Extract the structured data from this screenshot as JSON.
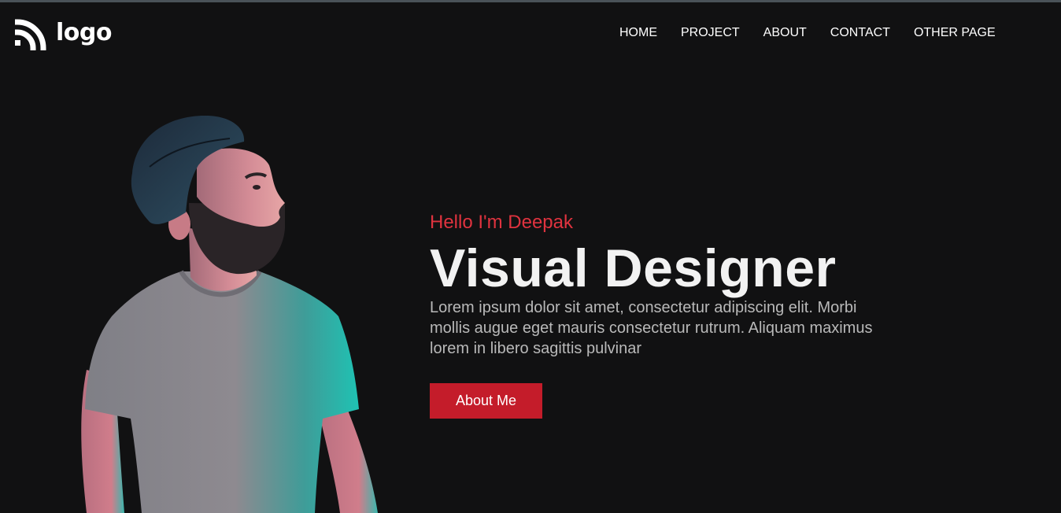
{
  "header": {
    "logo_text": "logo",
    "nav": [
      {
        "label": "HOME"
      },
      {
        "label": "PROJECT"
      },
      {
        "label": "ABOUT"
      },
      {
        "label": "CONTACT"
      },
      {
        "label": "OTHER PAGE"
      }
    ]
  },
  "hero": {
    "greeting": "Hello I'm Deepak",
    "headline": "Visual Designer",
    "description": "Lorem ipsum dolor sit amet, consectetur adipiscing elit. Morbi mollis augue eget mauris consectetur rutrum. Aliquam maximus lorem in libero sagittis pulvinar",
    "button_label": "About Me"
  },
  "colors": {
    "background": "#111112",
    "accent": "#c41c2a",
    "greeting": "#e0333f",
    "headline": "#f2f2f2",
    "body_text": "#b9b9b9"
  },
  "icons": {
    "logo_icon": "rss-arcs-icon"
  }
}
